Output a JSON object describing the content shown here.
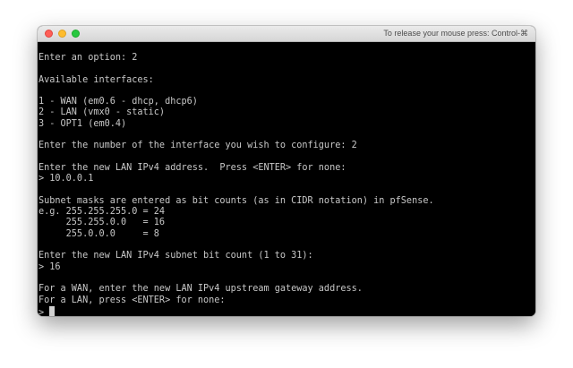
{
  "window": {
    "release_hint": "To release your mouse press: Control-⌘"
  },
  "console": {
    "lines": [
      "Enter an option: 2",
      "",
      "Available interfaces:",
      "",
      "1 - WAN (em0.6 - dhcp, dhcp6)",
      "2 - LAN (vmx0 - static)",
      "3 - OPT1 (em0.4)",
      "",
      "Enter the number of the interface you wish to configure: 2",
      "",
      "Enter the new LAN IPv4 address.  Press <ENTER> for none:",
      "> 10.0.0.1",
      "",
      "Subnet masks are entered as bit counts (as in CIDR notation) in pfSense.",
      "e.g. 255.255.255.0 = 24",
      "     255.255.0.0   = 16",
      "     255.0.0.0     = 8",
      "",
      "Enter the new LAN IPv4 subnet bit count (1 to 31):",
      "> 16",
      "",
      "For a WAN, enter the new LAN IPv4 upstream gateway address.",
      "For a LAN, press <ENTER> for none:"
    ],
    "prompt": "> "
  }
}
